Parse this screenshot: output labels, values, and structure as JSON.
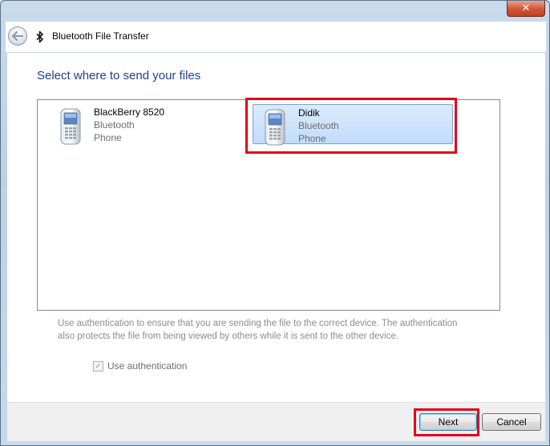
{
  "window": {
    "close_glyph": "✕"
  },
  "header": {
    "title": "Bluetooth File Transfer",
    "back_icon": "back-arrow-icon",
    "app_icon": "bluetooth-icon"
  },
  "main": {
    "title": "Select where to send your files",
    "devices": [
      {
        "name": "BlackBerry 8520",
        "type": "Bluetooth",
        "category": "Phone",
        "icon": "mobile-phone-icon",
        "selected": false
      },
      {
        "name": "Didik",
        "type": "Bluetooth",
        "category": "Phone",
        "icon": "mobile-phone-icon",
        "selected": true
      }
    ],
    "auth_description": "Use authentication to ensure that you are sending the file to the correct device. The authentication also protects the file from being viewed by others while it is sent to the other device.",
    "auth_checkbox": {
      "label": "Use authentication",
      "checked": true,
      "disabled": true
    }
  },
  "footer": {
    "next_label": "Next",
    "cancel_label": "Cancel"
  },
  "colors": {
    "title_blue": "#1e3f8f",
    "highlight_red": "#e3001b",
    "selection_blue": "#c1dcfc"
  }
}
